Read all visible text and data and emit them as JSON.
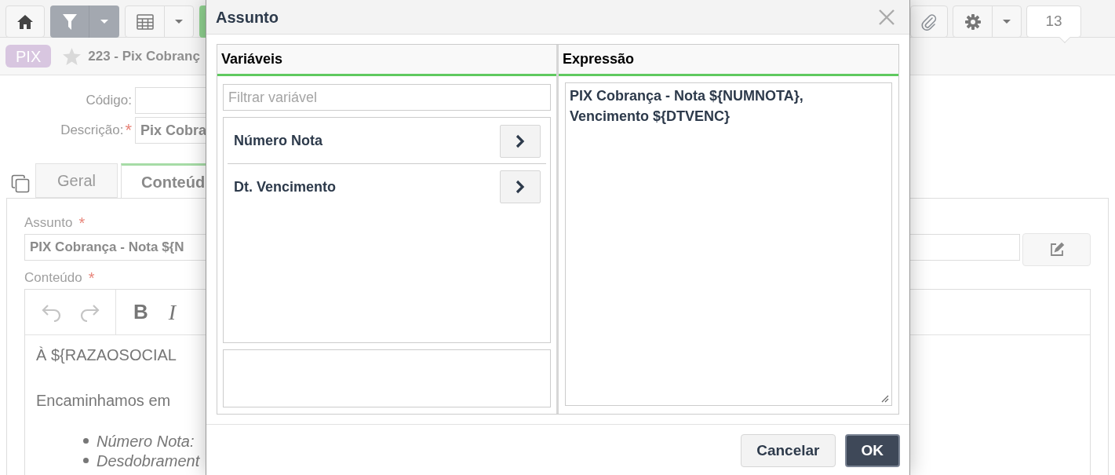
{
  "toolbar": {
    "badge": "13"
  },
  "record": {
    "tag": "PIX",
    "title": "223 - Pix Cobranç"
  },
  "form": {
    "fields": [
      {
        "label": "Código:"
      },
      {
        "label": "Descrição:",
        "required_mark": "*",
        "value": "Pix Cobra"
      }
    ]
  },
  "tabs": [
    {
      "label": "Geral",
      "selected": false
    },
    {
      "label": "Conteúd",
      "selected": true
    }
  ],
  "content": {
    "subject": {
      "label": "Assunto",
      "required_mark": "*",
      "value": "PIX Cobrança - Nota ${N"
    },
    "body": {
      "label": "Conteúdo",
      "required_mark": "*",
      "tools": [
        "B",
        "I"
      ],
      "paragraphs": [
        "À ${RAZAOSOCIAL",
        "Encaminhamos em"
      ],
      "list": [
        "Número Nota:",
        "Desdobrament"
      ]
    }
  },
  "dialog": {
    "title": "Assunto",
    "variables": {
      "heading": "Variáveis",
      "filter_placeholder": "Filtrar variável",
      "items": [
        "Número Nota",
        "Dt. Vencimento"
      ]
    },
    "expression": {
      "heading": "Expressão",
      "value": "PIX Cobrança - Nota ${NUMNOTA}, Vencimento ${DTVENC}"
    },
    "buttons": [
      {
        "label": "Cancelar",
        "kind": "secondary"
      },
      {
        "label": "OK",
        "kind": "primary"
      }
    ]
  }
}
